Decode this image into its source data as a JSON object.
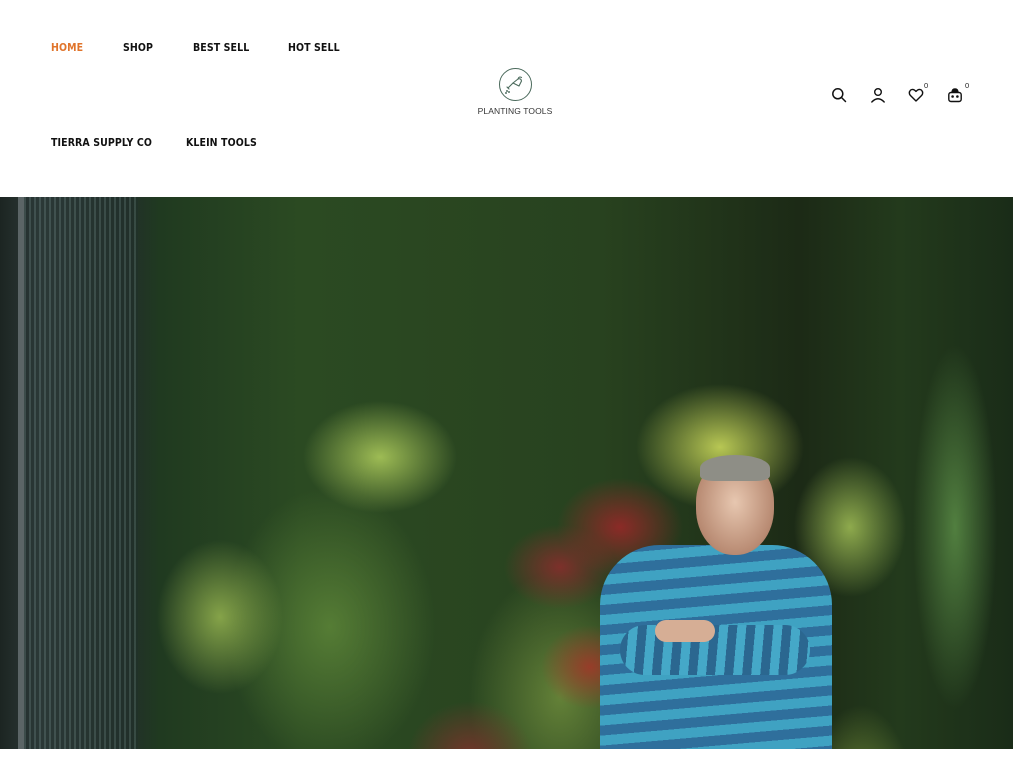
{
  "nav": {
    "primary": [
      {
        "label": "HOME",
        "active": true
      },
      {
        "label": "SHOP",
        "active": false
      },
      {
        "label": "BEST SELL",
        "active": false
      },
      {
        "label": "HOT SELL",
        "active": false
      }
    ],
    "secondary": [
      {
        "label": "TIERRA SUPPLY CO",
        "active": false
      },
      {
        "label": "KLEIN TOOLS",
        "active": false
      }
    ]
  },
  "logo": {
    "text": "PLANTING TOOLS",
    "icon": "watering-can-icon"
  },
  "header_icons": {
    "search": {
      "icon": "search-icon"
    },
    "account": {
      "icon": "user-icon"
    },
    "wishlist": {
      "icon": "heart-icon",
      "count": "0"
    },
    "cart": {
      "icon": "shopping-bag-icon",
      "count": "0"
    }
  },
  "colors": {
    "accent": "#e0742b",
    "text": "#111111",
    "logo_stroke": "#4b6a5c"
  },
  "hero": {
    "description": "Man in blue striped shirt standing in front of a vertical garden wall of green and red plants"
  }
}
